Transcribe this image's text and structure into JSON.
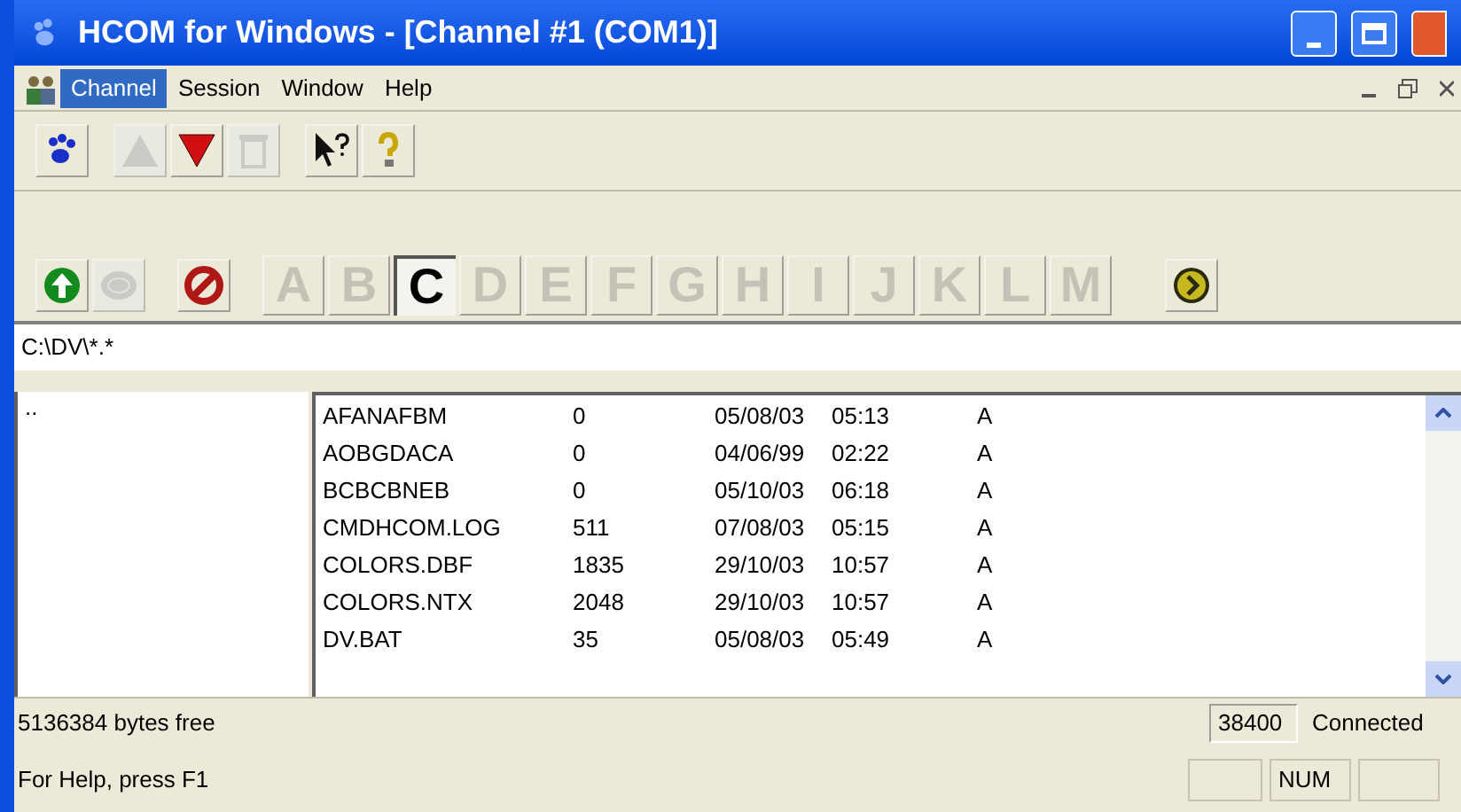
{
  "window": {
    "title": "HCOM for Windows - [Channel #1 (COM1)]"
  },
  "menu": [
    {
      "label": "Channel",
      "selected": true
    },
    {
      "label": "Session",
      "selected": false
    },
    {
      "label": "Window",
      "selected": false
    },
    {
      "label": "Help",
      "selected": false
    }
  ],
  "toolbar": [
    {
      "kind": "paw",
      "disabled": false
    },
    {
      "kind": "up",
      "disabled": true
    },
    {
      "kind": "down",
      "disabled": false
    },
    {
      "kind": "trash",
      "disabled": true
    },
    {
      "kind": "whatsthis",
      "disabled": false
    },
    {
      "kind": "hint",
      "disabled": false
    }
  ],
  "drive_bar": {
    "left": [
      {
        "kind": "up",
        "disabled": false
      },
      {
        "kind": "disk",
        "disabled": true
      },
      {
        "kind": "stop",
        "disabled": false
      }
    ],
    "drives": [
      {
        "label": "A",
        "selected": false
      },
      {
        "label": "B",
        "selected": false
      },
      {
        "label": "C",
        "selected": true
      },
      {
        "label": "D",
        "selected": false
      },
      {
        "label": "E",
        "selected": false
      },
      {
        "label": "F",
        "selected": false
      },
      {
        "label": "G",
        "selected": false
      },
      {
        "label": "H",
        "selected": false
      },
      {
        "label": "I",
        "selected": false
      },
      {
        "label": "J",
        "selected": false
      },
      {
        "label": "K",
        "selected": false
      },
      {
        "label": "L",
        "selected": false
      },
      {
        "label": "M",
        "selected": false
      }
    ]
  },
  "path": "C:\\DV\\*.*",
  "dirs": [
    ".."
  ],
  "files": [
    {
      "name": "AFANAFBM",
      "size": "0",
      "date": "05/08/03",
      "time": "05:13",
      "attr": "A"
    },
    {
      "name": "AOBGDACA",
      "size": "0",
      "date": "04/06/99",
      "time": "02:22",
      "attr": "A"
    },
    {
      "name": "BCBCBNEB",
      "size": "0",
      "date": "05/10/03",
      "time": "06:18",
      "attr": "A"
    },
    {
      "name": "CMDHCOM.LOG",
      "size": "511",
      "date": "07/08/03",
      "time": "05:15",
      "attr": "A"
    },
    {
      "name": "COLORS.DBF",
      "size": "1835",
      "date": "29/10/03",
      "time": "10:57",
      "attr": "A"
    },
    {
      "name": "COLORS.NTX",
      "size": "2048",
      "date": "29/10/03",
      "time": "10:57",
      "attr": "A"
    },
    {
      "name": "DV.BAT",
      "size": "35",
      "date": "05/08/03",
      "time": "05:49",
      "attr": "A"
    }
  ],
  "status": {
    "free": "5136384 bytes free",
    "baud": "38400",
    "connection": "Connected",
    "help": "For Help, press F1",
    "num": "NUM"
  }
}
